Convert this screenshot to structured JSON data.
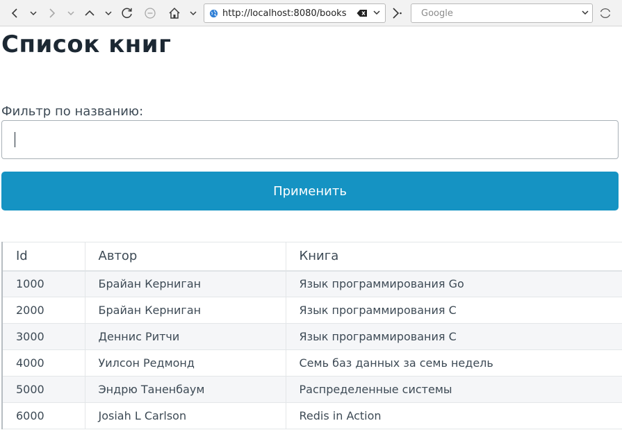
{
  "browser": {
    "url": "http://localhost:8080/books",
    "search_placeholder": "Google"
  },
  "page": {
    "title": "Список книг",
    "filter_label": "Фильтр по названию:",
    "filter_value": "",
    "apply_label": "Применить"
  },
  "table": {
    "headers": [
      "Id",
      "Автор",
      "Книга"
    ],
    "rows": [
      [
        "1000",
        "Брайан Керниган",
        "Язык программирования Go"
      ],
      [
        "2000",
        "Брайан Керниган",
        "Язык программирования C"
      ],
      [
        "3000",
        "Деннис Ритчи",
        "Язык программирования C"
      ],
      [
        "4000",
        "Уилсон Редмонд",
        "Семь баз данных за семь недель"
      ],
      [
        "5000",
        "Эндрю Таненбаум",
        "Распределенные системы"
      ],
      [
        "6000",
        "Josiah L Carlson",
        "Redis in Action"
      ]
    ]
  },
  "colors": {
    "accent": "#1593c3",
    "title": "#1c2833",
    "text": "#3d4a55",
    "stripe": "#f5f6f8"
  }
}
